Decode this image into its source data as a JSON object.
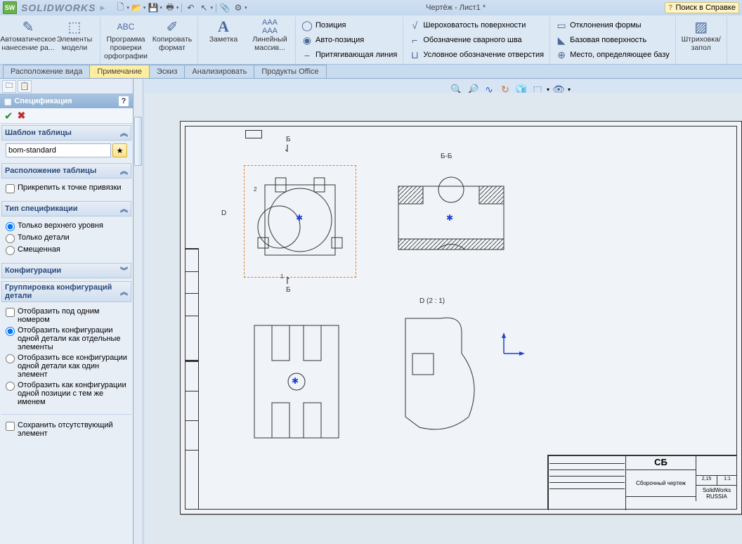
{
  "app": {
    "name": "SOLIDWORKS",
    "doc_title": "Чертёж - Лист1 *",
    "help_search": "Поиск в Справке"
  },
  "ribbon": {
    "btn_auto_dim": "Автоматическое нанесение ра...",
    "btn_model_items": "Элементы модели",
    "btn_spellcheck": "Программа проверки орфографии",
    "btn_copy_format": "Копировать формат",
    "btn_note": "Заметка",
    "btn_linear_pattern": "Линейный массив...",
    "btn_position": "Позиция",
    "btn_auto_position": "Авто-позиция",
    "btn_magnetic_line": "Притягивающая линия",
    "btn_surface_finish": "Шероховатость поверхности",
    "btn_weld_symbol": "Обозначение сварного шва",
    "btn_hole_callout": "Условное обозначение отверстия",
    "btn_geom_tol": "Отклонения формы",
    "btn_datum": "Базовая поверхность",
    "btn_datum_target": "Место, определяющее базу",
    "btn_hatch": "Штриховка/запол"
  },
  "tabs": {
    "t1": "Расположение вида",
    "t2": "Примечание",
    "t3": "Эскиз",
    "t4": "Анализировать",
    "t5": "Продукты Office"
  },
  "pm": {
    "title": "Спецификация",
    "sec_template": "Шаблон таблицы",
    "template_value": "bom-standard",
    "sec_tablepos": "Расположение таблицы",
    "chk_attach": "Прикрепить к точке привязки",
    "sec_bomtype": "Тип спецификации",
    "r_toplevel": "Только верхнего уровня",
    "r_parts": "Только детали",
    "r_indented": "Смещенная",
    "sec_configs": "Конфигурации",
    "sec_grouping": "Группировка конфигураций детали",
    "chk_one_item": "Отобразить под одним номером",
    "r_sep": "Отобразить конфигурации одной детали как отдельные элементы",
    "r_one": "Отобразить все конфигурации одной детали как один элемент",
    "r_same": "Отобразить как конфигурации одной позиции с тем же именем",
    "chk_keep_missing": "Сохранить отсутствующий элемент"
  },
  "drawing": {
    "section_label_top": "Б-Б",
    "cut_arrow_B_top": "Б",
    "cut_arrow_B_bot": "Б",
    "detail_D": "D",
    "detail_view_label": "D  (2 : 1)",
    "tb_designation": "СБ",
    "tb_assy": "Сборочный чертеж",
    "tb_company": "SolidWorks RUSSIA",
    "dim_mass": "2,15",
    "dim_scale": "1:1"
  }
}
